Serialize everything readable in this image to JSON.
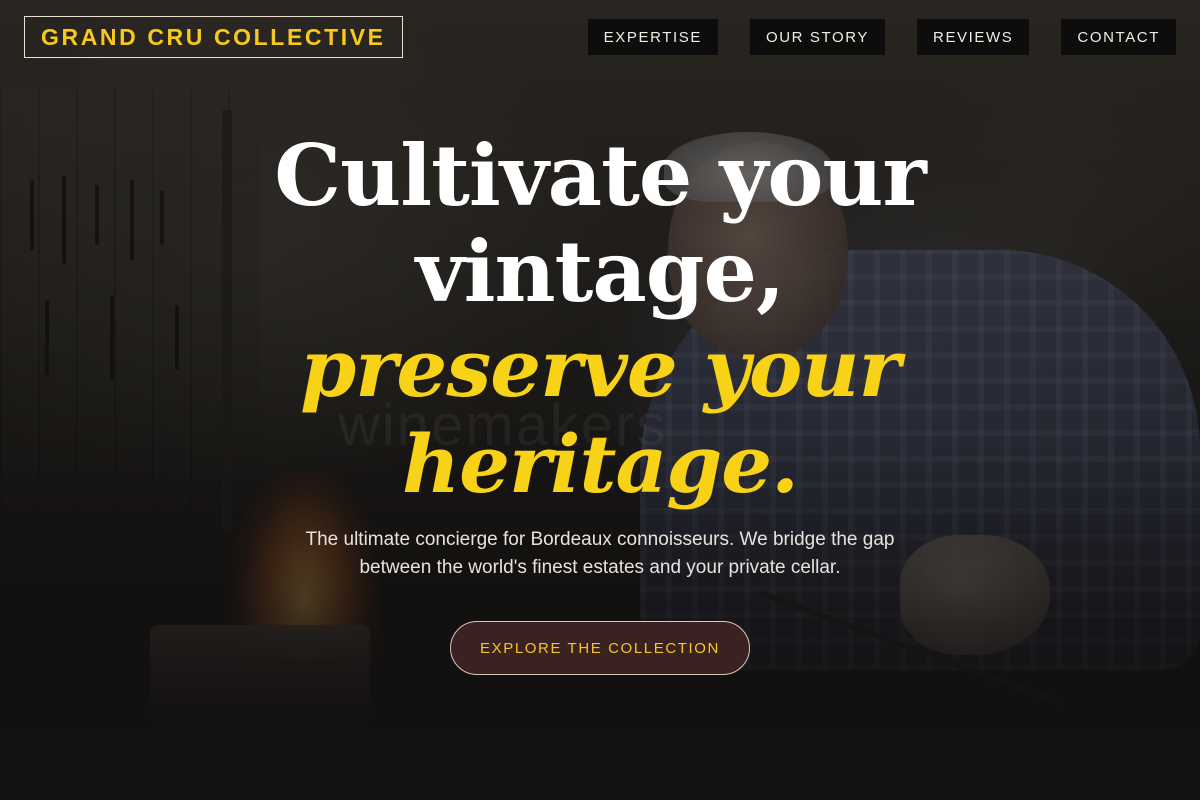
{
  "brand": {
    "logo_text": "GRAND CRU COLLECTIVE"
  },
  "nav": {
    "items": [
      {
        "label": "EXPERTISE"
      },
      {
        "label": "OUR STORY"
      },
      {
        "label": "REVIEWS"
      },
      {
        "label": "CONTACT"
      }
    ]
  },
  "hero": {
    "headline_line1": "Cultivate your",
    "headline_line2": "vintage,",
    "headline_line3": "preserve your",
    "headline_line4": "heritage.",
    "subtitle_line1": "The ultimate concierge for Bordeaux connoisseurs. We bridge the gap",
    "subtitle_line2": "between the world's finest estates and your private cellar.",
    "cta_label": "EXPLORE THE COLLECTION",
    "background_watermark": "winemakers"
  },
  "colors": {
    "accent_gold": "#f8d217",
    "cta_background": "#3a2220",
    "page_background": "#141212"
  }
}
